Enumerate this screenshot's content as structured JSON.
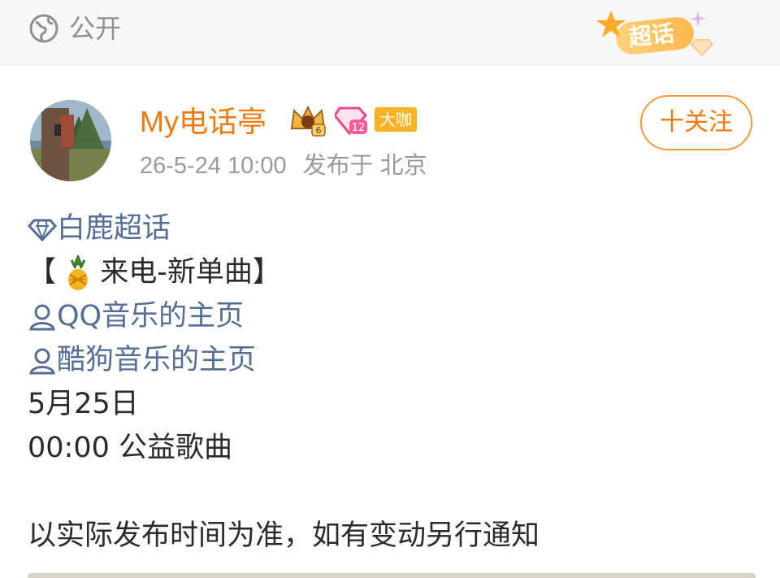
{
  "header": {
    "visibility_label": "公开",
    "visibility_icon": "globe-icon",
    "supertopic_badge": "超话"
  },
  "post": {
    "author": {
      "name": "My电话亭",
      "level_tag": "大咖",
      "crown_level": "6",
      "gem_level": "12"
    },
    "time": "26-5-24 10:00",
    "location": "发布于 北京",
    "follow_label": "十关注",
    "content": {
      "topic": "白鹿超话",
      "title_open": "【",
      "title": "来电-新单曲】",
      "link1": "QQ音乐的主页",
      "link2": "酷狗音乐的主页",
      "date": "5月25日",
      "time_desc": "00:00 公益歌曲",
      "note": "以实际发布时间为准，如有变动另行通知"
    }
  },
  "colors": {
    "username": "#f07a0d",
    "link": "#566d95",
    "follow_border": "#f29b3c",
    "level_tag_bg": "#ffb21f"
  }
}
